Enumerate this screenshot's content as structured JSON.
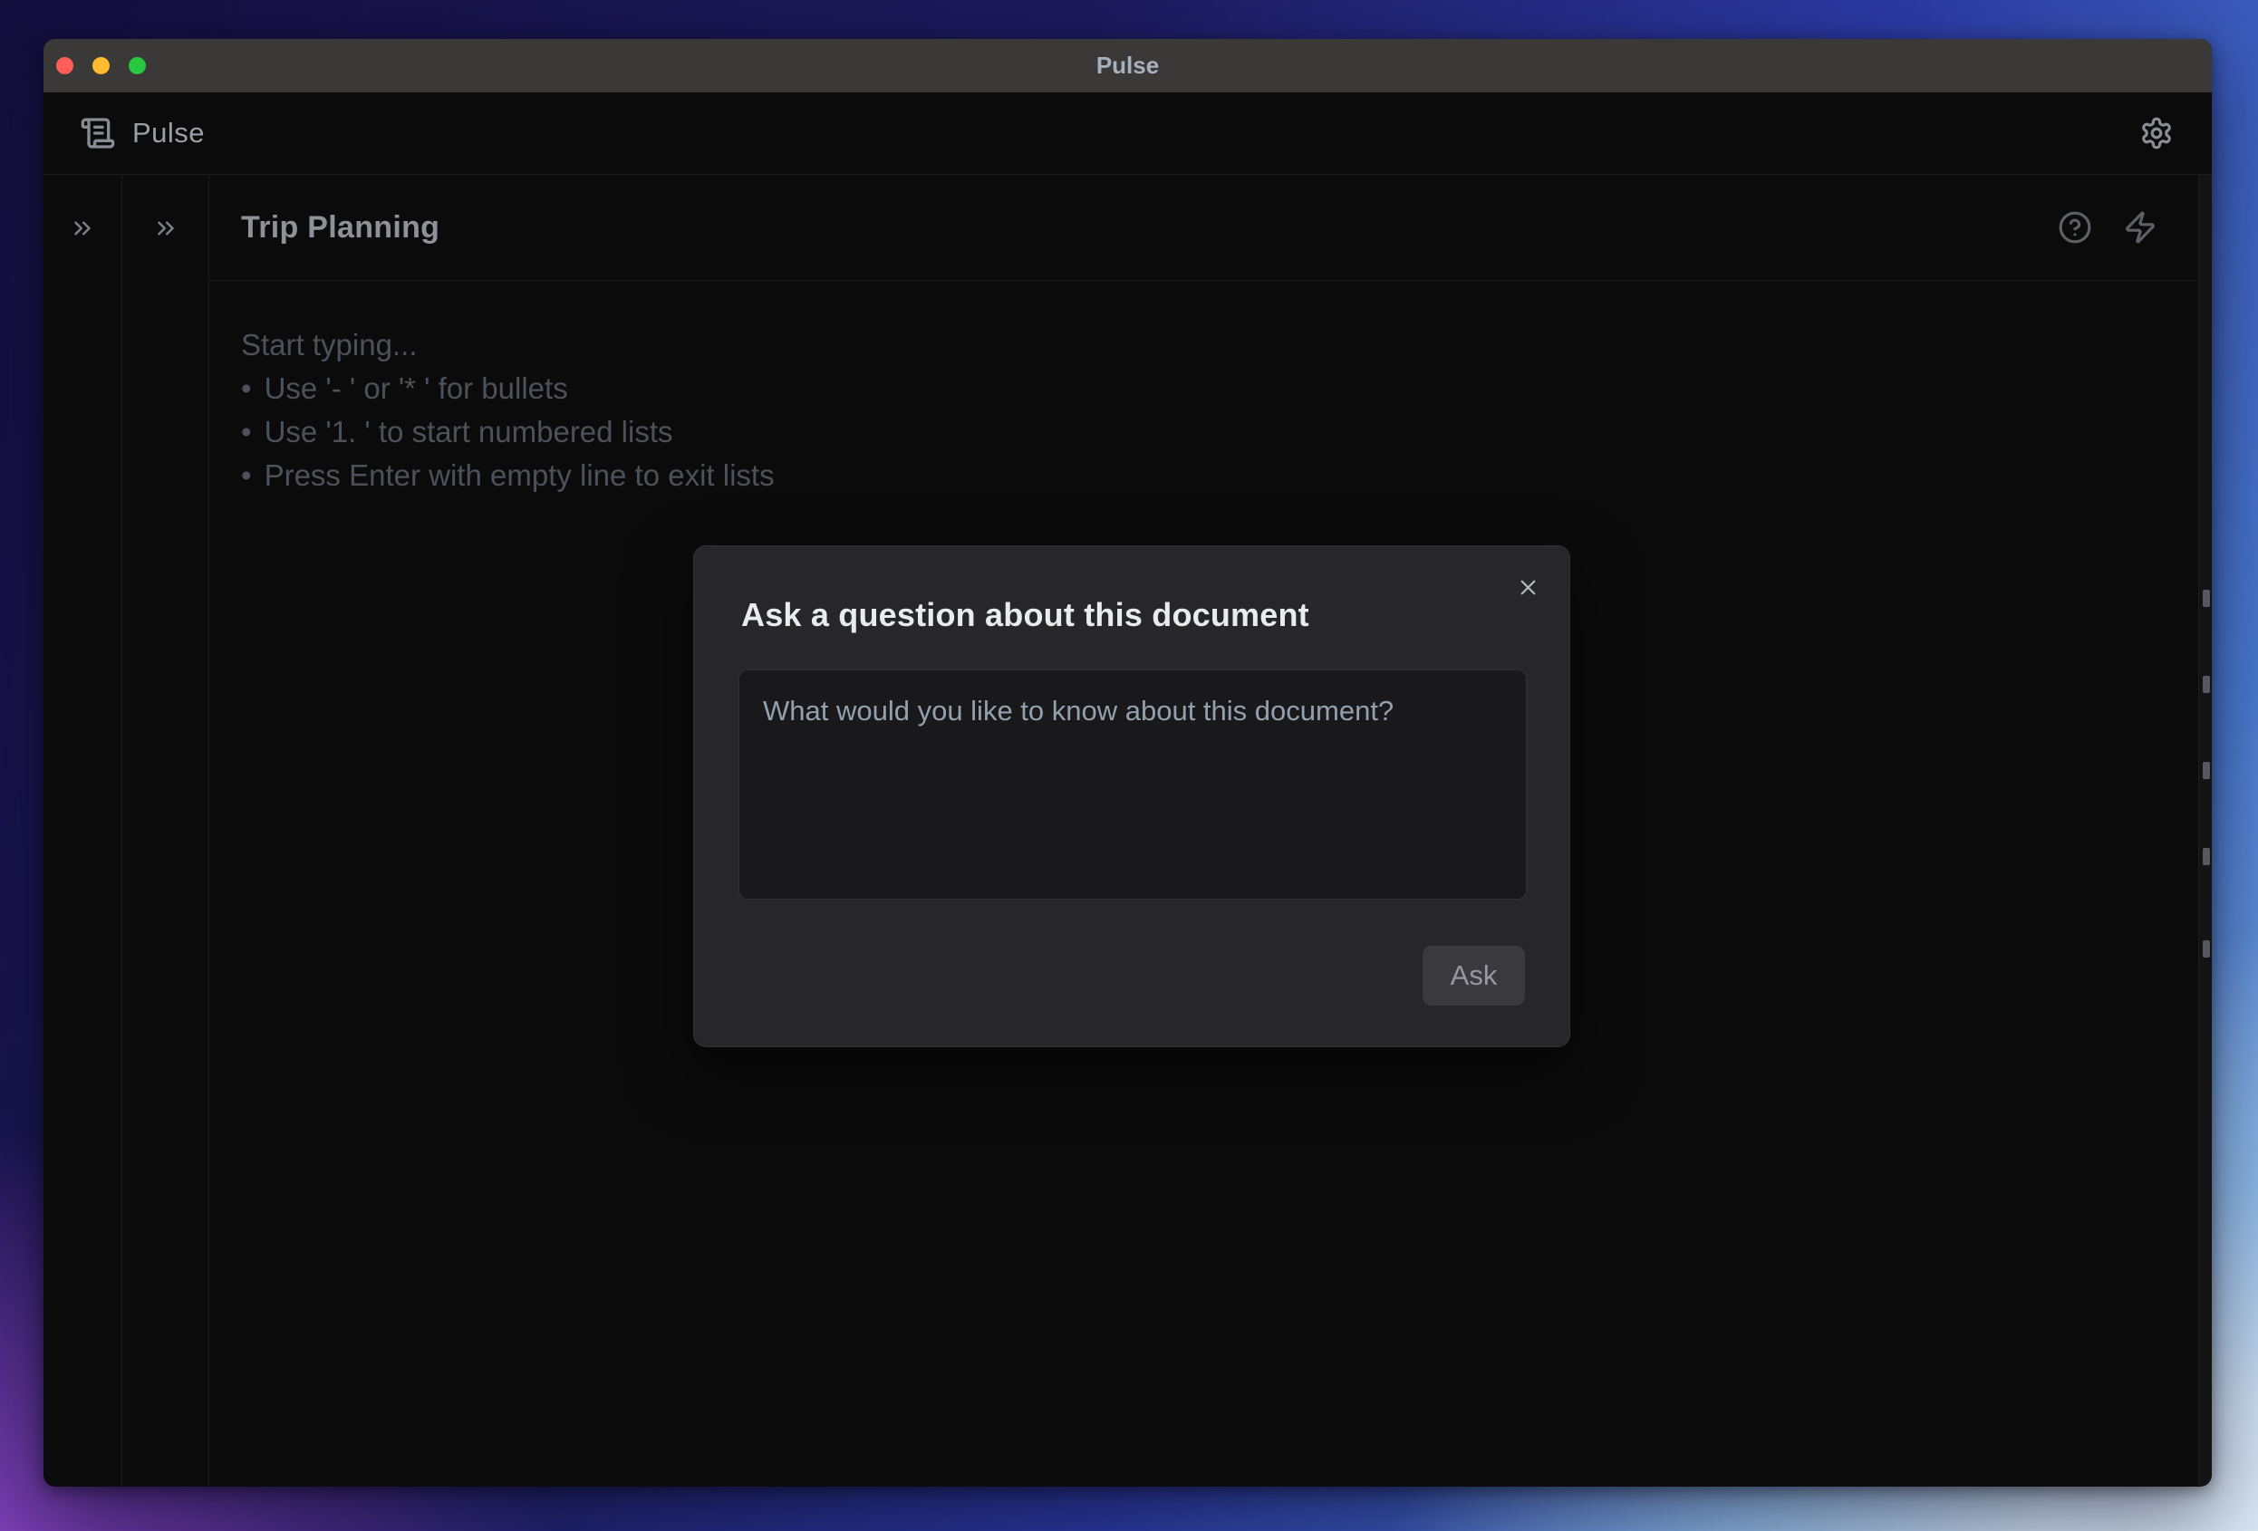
{
  "window": {
    "title": "Pulse"
  },
  "app_header": {
    "brand": "Pulse",
    "logo_icon": "scroll-text-icon",
    "settings_icon": "gear-icon"
  },
  "sidebars": {
    "outer_expand_icon": "chevrons-right-icon",
    "inner_expand_icon": "chevrons-right-icon"
  },
  "document": {
    "title": "Trip Planning",
    "header_icons": [
      "help-circle-icon",
      "zap-icon"
    ],
    "placeholder": {
      "heading": "Start typing...",
      "bullet": "•",
      "tips": [
        "Use '- ' or '* ' for bullets",
        "Use '1. ' to start numbered lists",
        "Press Enter with empty line to exit lists"
      ]
    }
  },
  "dialog": {
    "title": "Ask a question about this document",
    "close_icon": "x-icon",
    "textarea_placeholder": "What would you like to know about this document?",
    "ask_label": "Ask"
  },
  "colors": {
    "titlebar": "#3b3938",
    "window_bg": "#0b0b0c",
    "dialog_bg": "#272729",
    "textarea_bg": "#19191b",
    "ask_button_bg": "#3a3a3e",
    "traffic_close": "#ff5f57",
    "traffic_minimize": "#febc2e",
    "traffic_zoom": "#28c840",
    "dialog_title_text": "#e9ebee",
    "placeholder_text": "#4c515a",
    "wallpaper_top_left": "#150f3e",
    "wallpaper_top_right": "#2c3aa4",
    "wallpaper_bottom_left": "#a04ed8",
    "wallpaper_bottom_right": "#eef3f9"
  }
}
